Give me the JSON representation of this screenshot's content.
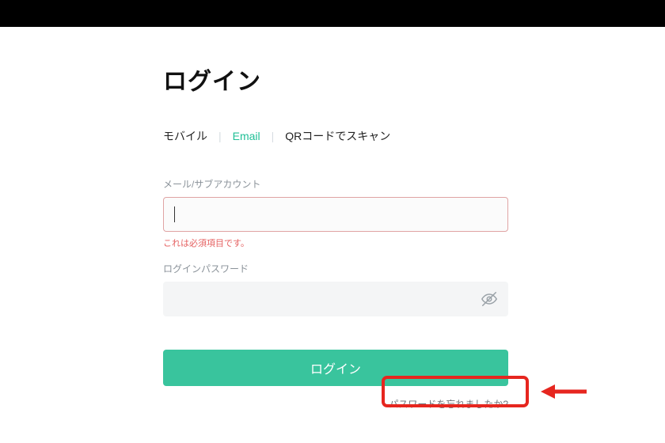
{
  "title": "ログイン",
  "tabs": {
    "mobile": "モバイル",
    "email": "Email",
    "qr": "QRコードでスキャン"
  },
  "fields": {
    "email_label": "メール/サブアカウント",
    "email_value": "",
    "email_error": "これは必須項目です。",
    "password_label": "ログインパスワード",
    "password_value": ""
  },
  "buttons": {
    "submit": "ログイン"
  },
  "links": {
    "forgot": "パスワードを忘れましたか?"
  },
  "colors": {
    "accent": "#39c49d",
    "error": "#e56161",
    "highlight": "#e6261f"
  }
}
